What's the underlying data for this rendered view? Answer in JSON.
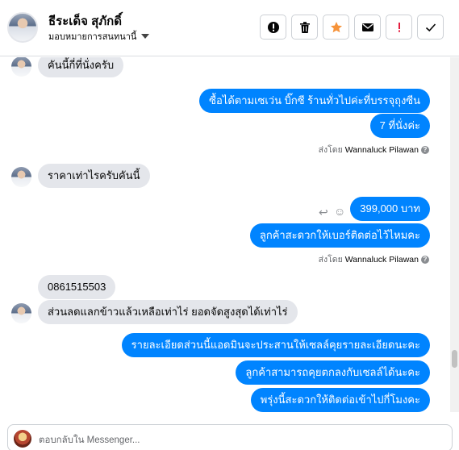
{
  "header": {
    "contact_name": "ธีระเด็จ สุภักดิ์",
    "assign_label": "มอบหมายการสนทนานี้"
  },
  "toolbar": [
    {
      "name": "mark-spam-button",
      "icon": "exclamation-circle-icon",
      "color": "#050505"
    },
    {
      "name": "delete-button",
      "icon": "trash-icon",
      "color": "#050505"
    },
    {
      "name": "star-button",
      "icon": "star-icon",
      "color": "#f6933a"
    },
    {
      "name": "mark-unread-button",
      "icon": "envelope-icon",
      "color": "#050505"
    },
    {
      "name": "follow-up-button",
      "icon": "exclamation-icon",
      "color": "#e41e3f"
    },
    {
      "name": "mark-done-button",
      "icon": "check-icon",
      "color": "#050505"
    }
  ],
  "messages": [
    {
      "dir": "in",
      "text": "คันนี้กี่ที่นั่งครับ",
      "avatar": true
    },
    {
      "dir": "out",
      "text": "ซื้อได้ตามเซเว่น บิ๊กซี ร้านทั่วไปค่ะที่บรรจุถุงซีน"
    },
    {
      "dir": "out",
      "text": "7 ที่นั่งค่ะ"
    },
    {
      "dir": "in",
      "text": "ราคาเท่าไรครับคันนี้",
      "avatar": true
    },
    {
      "dir": "out",
      "text": "399,000  บาท"
    },
    {
      "dir": "out",
      "text": "ลูกค้าสะดวกให้เบอร์ติดต่อไว้ไหมคะ"
    },
    {
      "dir": "in",
      "text": "0861515503"
    },
    {
      "dir": "in",
      "text": "ส่วนลดแลกข้าวแล้วเหลือเท่าไร่ ยอดจัดสูงสุดได้เท่าไร่",
      "avatar": true
    },
    {
      "dir": "out",
      "text": "รายละเอียดส่วนนี้แอดมินจะประสานให้เซลล์คุยรายละเอียดนะคะ"
    },
    {
      "dir": "out",
      "text": "ลูกค้าสามารถคุยตกลงกับเซลล์ได้นะคะ"
    },
    {
      "dir": "out",
      "text": "พรุ่งนี้สะดวกให้ติดต่อเข้าไปกี่โมงคะ"
    }
  ],
  "sent_by": {
    "prefix": "ส่งโดย",
    "agent": "Wannaluck Pilawan"
  },
  "composer": {
    "placeholder": "ตอบกลับใน Messenger..."
  },
  "colors": {
    "outgoing_bubble": "#0084ff",
    "incoming_bubble": "#e4e6eb"
  }
}
